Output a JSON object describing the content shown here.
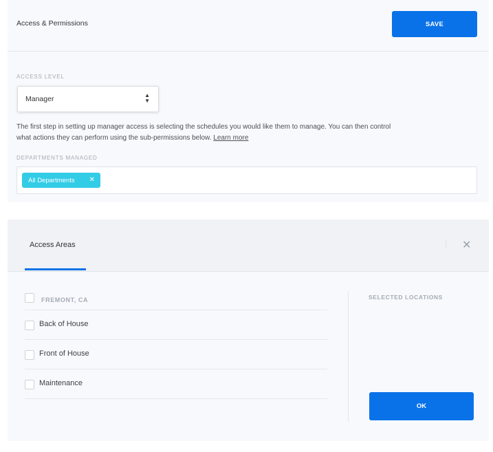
{
  "access_panel": {
    "title": "Access & Permissions",
    "save_label": "SAVE",
    "access_level_label": "ACCESS LEVEL",
    "access_level_value": "Manager",
    "description": "The first step in setting up manager access is selecting the schedules you would like them to manage. You can then control what actions they can perform using the sub-permissions below.",
    "learn_more": "Learn more",
    "departments_label": "DEPARTMENTS MANAGED",
    "department_tags": [
      {
        "label": "All Departments"
      }
    ]
  },
  "access_areas": {
    "tab_label": "Access Areas",
    "group_label": "FREMONT, CA",
    "items": [
      {
        "label": "Back of House",
        "checked": false
      },
      {
        "label": "Front of House",
        "checked": false
      },
      {
        "label": "Maintenance",
        "checked": false
      }
    ],
    "selected_label": "SELECTED LOCATIONS",
    "ok_label": "OK"
  },
  "icons": {
    "select_arrows": "up-down-caret-icon",
    "tag_remove": "close-icon",
    "dialog_close": "close-icon"
  },
  "colors": {
    "primary": "#0a72e8",
    "tag": "#33cce6",
    "panel_bg": "#f8f9fc"
  }
}
